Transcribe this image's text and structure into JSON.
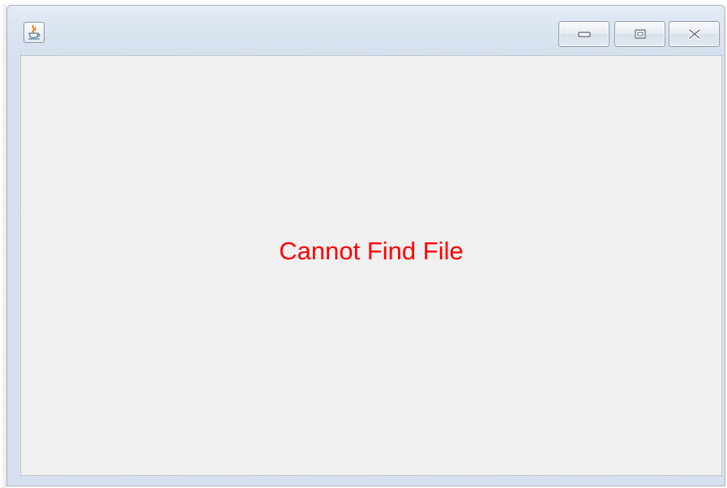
{
  "window": {
    "title": "",
    "icon": "java-coffee-cup-icon",
    "controls": {
      "minimize_icon": "minimize-icon",
      "maximize_icon": "maximize-icon",
      "close_icon": "close-icon"
    }
  },
  "content": {
    "message": "Cannot Find File",
    "message_color": "#ff0000",
    "background_color": "#f0f0f0"
  },
  "colors": {
    "titlebar": "#dbe4f1",
    "border": "#a9b1bb"
  }
}
